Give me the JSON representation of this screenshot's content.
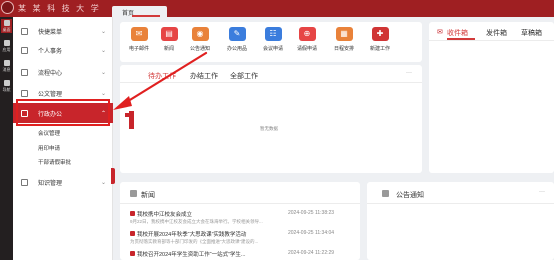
{
  "header": {
    "brand": "某 某 科 技 大 学",
    "home_tab": "首页"
  },
  "iconstrip": {
    "items": [
      {
        "label": "桌面",
        "icon": "desktop-icon"
      },
      {
        "label": "应用",
        "icon": "apps-icon"
      },
      {
        "label": "消息",
        "icon": "message-icon"
      },
      {
        "label": "导航",
        "icon": "nav-icon"
      }
    ]
  },
  "sidebar": {
    "items": [
      {
        "label": "快捷菜单",
        "icon": "shortcut-icon"
      },
      {
        "label": "个人事务",
        "icon": "person-icon"
      },
      {
        "label": "流程中心",
        "icon": "flow-icon"
      },
      {
        "label": "公文管理",
        "icon": "document-icon"
      },
      {
        "label": "行政办公",
        "icon": "office-icon"
      },
      {
        "label": "知识管理",
        "icon": "knowledge-icon"
      }
    ],
    "subitems": [
      "会议管理",
      "用印申请",
      "干部请假审批"
    ]
  },
  "apps": [
    {
      "name": "电子邮件",
      "color": "#e9823a",
      "icon": "mail-icon"
    },
    {
      "name": "新闻",
      "color": "#e64545",
      "icon": "news-icon"
    },
    {
      "name": "公告通知",
      "color": "#e9823a",
      "icon": "announcement-icon"
    },
    {
      "name": "办公用品",
      "color": "#3b7ddd",
      "icon": "supplies-icon"
    },
    {
      "name": "会议申请",
      "color": "#3b7ddd",
      "icon": "meeting-icon"
    },
    {
      "name": "请假申请",
      "color": "#e64545",
      "icon": "leave-icon"
    },
    {
      "name": "日程安排",
      "color": "#e9823a",
      "icon": "calendar-icon"
    },
    {
      "name": "新建工作",
      "color": "#d03535",
      "icon": "new-work-icon"
    }
  ],
  "work": {
    "tabs": [
      "待办工作",
      "办结工作",
      "全部工作"
    ],
    "empty": "暂无数据",
    "more": "···"
  },
  "mail": {
    "tabs": [
      "收件箱",
      "发件箱",
      "草稿箱"
    ]
  },
  "news": {
    "title": "新闻",
    "rows": [
      {
        "title": "我校携中江校友会成立",
        "sub": "9月22日，我校携中江校友会成立大会在珠海举行。学校相关领导...",
        "date": "2024-09-25 11:38:23"
      },
      {
        "title": "我校开展2024年秋季“大思政课”实践教学活动",
        "sub": "为贯彻落实教育部等十部门印发的《全面推进“大思政课”建设的...",
        "date": "2024-09-25 11:34:04"
      },
      {
        "title": "我校召开2024年学生资助工作“一站式”学生...",
        "sub": "",
        "date": "2024-09-24 11:22:29"
      }
    ]
  },
  "notice": {
    "title": "公告通知",
    "more": "···"
  }
}
